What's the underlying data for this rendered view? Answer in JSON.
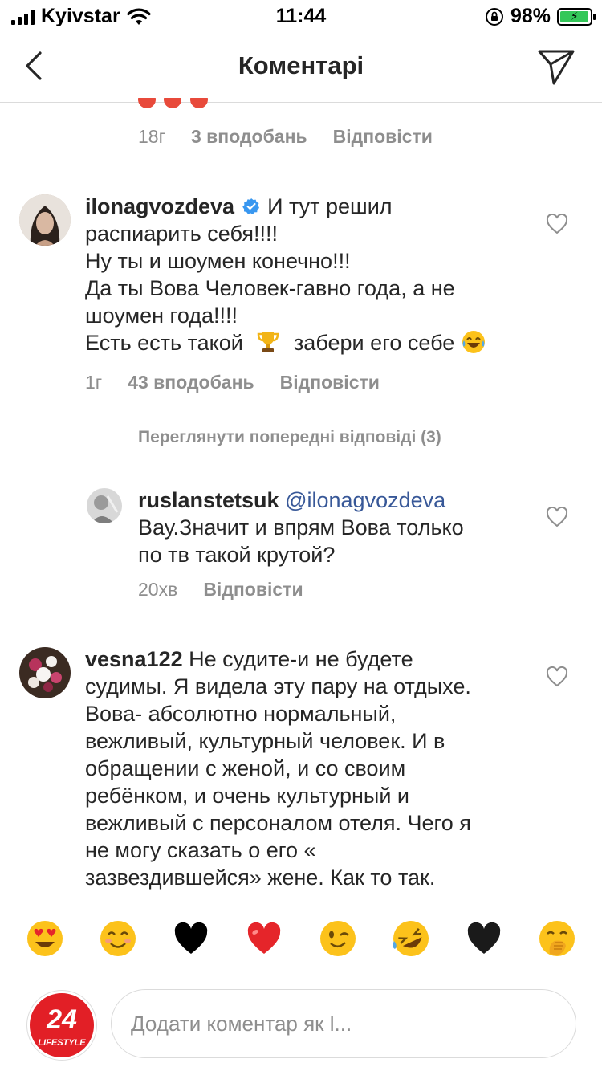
{
  "status_bar": {
    "carrier": "Kyivstar",
    "time": "11:44",
    "battery_percent": "98%",
    "battery_level": 0.98
  },
  "nav": {
    "title": "Коментарі",
    "back_icon": "chevron-left-icon",
    "share_icon": "paper-plane-icon"
  },
  "top_comment_meta": {
    "time": "18г",
    "likes": "3 вподобань",
    "reply": "Відповісти"
  },
  "comments": [
    {
      "username": "ilonagvozdeva",
      "verified": true,
      "lines": [
        "И тут решил",
        "распиарить себя!!!!",
        "Ну ты и шоумен конечно!!!",
        "Да ты Вова Человек-гавно года, а не",
        "шоумен года!!!!",
        "Есть есть такой",
        "забери его себе"
      ],
      "time": "1г",
      "likes": "43 вподобань",
      "reply": "Відповісти"
    },
    {
      "view_previous": "Переглянути попередні відповіді (3)"
    },
    {
      "username": "ruslanstetsuk",
      "mention": "@ilonagvozdeva",
      "lines": [
        "Вау.Значит и впрям Вова только",
        "по тв такой крутой?"
      ],
      "time": "20хв",
      "reply": "Відповісти"
    },
    {
      "username": "vesna122",
      "lines": [
        "Не судите-и не будете",
        "судимы. Я видела эту пару на отдыхе.",
        "Вова- абсолютно нормальный,",
        "вежливый, культурный человек. И в",
        "обращении с женой, и со своим",
        "ребёнком, и очень культурный и",
        "вежливый с персоналом отеля. Чего я",
        "не могу сказать о его «",
        "зазвездившейся» жене. Как то так."
      ]
    }
  ],
  "emoji_bar": [
    "heart-eyes",
    "smiling-face",
    "black-heart",
    "red-heart",
    "winking-face",
    "rolling-laughing",
    "black-heart",
    "face-hand-over-mouth"
  ],
  "composer": {
    "placeholder": "Додати коментар як l...",
    "logo_number": "24",
    "logo_sub": "LIFESTYLE"
  }
}
